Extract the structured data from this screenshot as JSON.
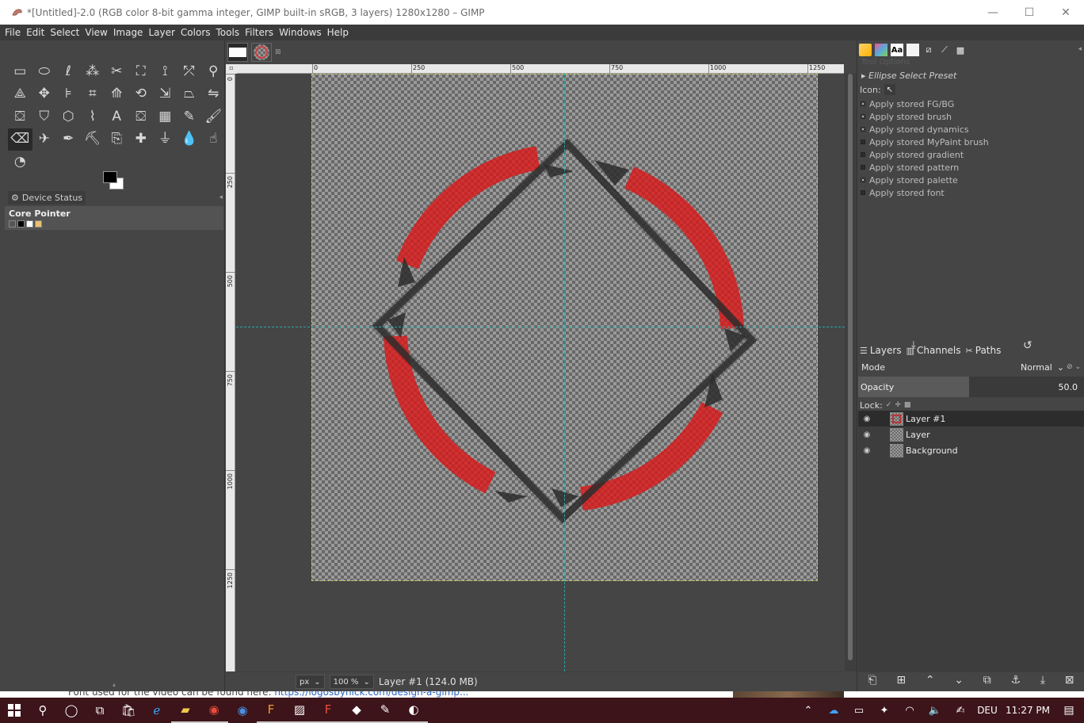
{
  "window": {
    "title": "*[Untitled]-2.0 (RGB color 8-bit gamma integer, GIMP built-in sRGB, 3 layers) 1280x1280 – GIMP",
    "minimize": "—",
    "maximize": "☐",
    "close": "✕"
  },
  "menu": [
    "File",
    "Edit",
    "Select",
    "View",
    "Image",
    "Layer",
    "Colors",
    "Tools",
    "Filters",
    "Windows",
    "Help"
  ],
  "toolbox": {
    "tools": [
      {
        "name": "rect-select-icon",
        "glyph": "▭"
      },
      {
        "name": "ellipse-select-icon",
        "glyph": "⬭"
      },
      {
        "name": "free-select-icon",
        "glyph": "ℓ"
      },
      {
        "name": "fuzzy-select-icon",
        "glyph": "⁂"
      },
      {
        "name": "scissors-select-icon",
        "glyph": "✂"
      },
      {
        "name": "foreground-select-icon",
        "glyph": "⛶"
      },
      {
        "name": "paths-icon",
        "glyph": "⟟"
      },
      {
        "name": "color-picker-icon",
        "glyph": "⤱"
      },
      {
        "name": "magnify-icon",
        "glyph": "⚲"
      },
      {
        "name": "measure-icon",
        "glyph": "⟁"
      },
      {
        "name": "move-icon",
        "glyph": "✥"
      },
      {
        "name": "align-icon",
        "glyph": "⊧"
      },
      {
        "name": "crop-icon",
        "glyph": "⌗"
      },
      {
        "name": "unified-transform-icon",
        "glyph": "⟰"
      },
      {
        "name": "rotate-icon",
        "glyph": "⟲"
      },
      {
        "name": "scale-icon",
        "glyph": "⇲"
      },
      {
        "name": "shear-icon",
        "glyph": "⏢"
      },
      {
        "name": "flip-icon",
        "glyph": "⇋"
      },
      {
        "name": "handle-transform-icon",
        "glyph": "⛋"
      },
      {
        "name": "perspective-icon",
        "glyph": "⛉"
      },
      {
        "name": "cage-transform-icon",
        "glyph": "⬡"
      },
      {
        "name": "warp-transform-icon",
        "glyph": "⌇"
      },
      {
        "name": "text-icon",
        "glyph": "A"
      },
      {
        "name": "bucket-fill-icon",
        "glyph": "⛋"
      },
      {
        "name": "blend-icon",
        "glyph": "▦"
      },
      {
        "name": "pencil-icon",
        "glyph": "✎"
      },
      {
        "name": "paintbrush-icon",
        "glyph": "🖌"
      },
      {
        "name": "eraser-icon",
        "glyph": "⌫"
      },
      {
        "name": "airbrush-icon",
        "glyph": "✈"
      },
      {
        "name": "ink-icon",
        "glyph": "✒"
      },
      {
        "name": "mypaint-brush-icon",
        "glyph": "⛏"
      },
      {
        "name": "clone-icon",
        "glyph": "⎘"
      },
      {
        "name": "heal-icon",
        "glyph": "✚"
      },
      {
        "name": "perspective-clone-icon",
        "glyph": "⏚"
      },
      {
        "name": "blur-icon",
        "glyph": "💧"
      },
      {
        "name": "smudge-icon",
        "glyph": "☝"
      },
      {
        "name": "dodge-burn-icon",
        "glyph": "◔"
      }
    ],
    "active_tool_index": 27,
    "device_status_label": "Device Status",
    "core_pointer_label": "Core Pointer"
  },
  "image_window": {
    "ruler_labels": [
      "0",
      "250",
      "500",
      "750",
      "1000",
      "1250"
    ],
    "vruler_labels": [
      "0",
      "250",
      "500",
      "750",
      "1000",
      "1250"
    ],
    "unit": "px",
    "zoom": "100 %",
    "status": "Layer #1 (124.0 MB)"
  },
  "dock": {
    "options_header": "Tool Options",
    "preset_label": "Ellipse Select Preset",
    "icon_label": "Icon:",
    "apply_items": [
      {
        "label": "Apply stored FG/BG",
        "checked": true
      },
      {
        "label": "Apply stored brush",
        "checked": true
      },
      {
        "label": "Apply stored dynamics",
        "checked": true
      },
      {
        "label": "Apply stored MyPaint brush",
        "checked": false
      },
      {
        "label": "Apply stored gradient",
        "checked": false
      },
      {
        "label": "Apply stored pattern",
        "checked": false
      },
      {
        "label": "Apply stored palette",
        "checked": true
      },
      {
        "label": "Apply stored font",
        "checked": false
      }
    ],
    "tabs": [
      "Layers",
      "Channels",
      "Paths"
    ],
    "mode_label": "Mode",
    "mode_value": "Normal",
    "opacity_label": "Opacity",
    "opacity_value": "50.0",
    "lock_label": "Lock:",
    "layers": [
      {
        "name": "Layer #1",
        "selected": true
      },
      {
        "name": "Layer",
        "selected": false
      },
      {
        "name": "Background",
        "selected": false
      }
    ]
  },
  "behind": {
    "text": "Font used for the video can be found here: ",
    "link": "https://logosbynick.com/design-a-gimp..."
  },
  "taskbar": {
    "language": "DEU",
    "time": "11:27 PM"
  }
}
